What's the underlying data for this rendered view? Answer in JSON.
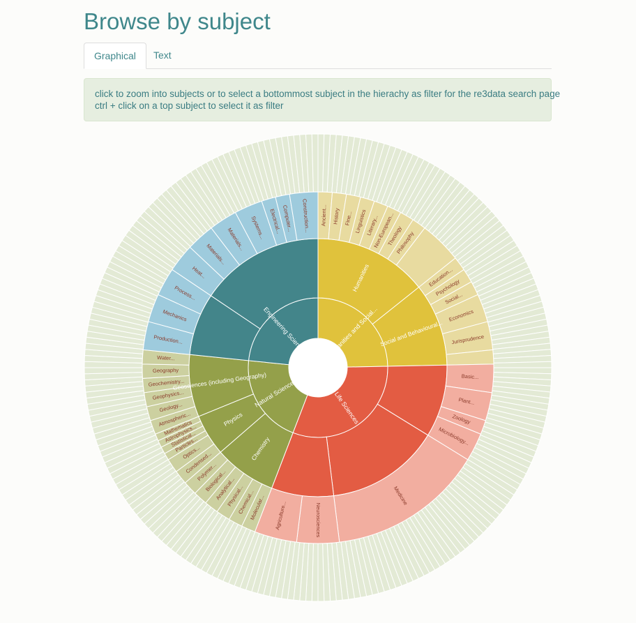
{
  "page": {
    "title": "Browse by subject",
    "tabs": [
      {
        "label": "Graphical",
        "active": true
      },
      {
        "label": "Text",
        "active": false
      }
    ],
    "info_lines": [
      "click to zoom into subjects or to select a bottommost subject in the hierachy as filter for the re3data search page",
      "ctrl + click on a top subject to select it as filter"
    ]
  },
  "colors": {
    "humanities": [
      "#e0c23c",
      "#e8dba0"
    ],
    "life": [
      "#e35c43",
      "#f2aea0"
    ],
    "natural": [
      "#94a04a",
      "#ccd0a0"
    ],
    "engineering": [
      "#43858a",
      "#9ecbdd"
    ],
    "outer": "#e3ead5"
  },
  "chart_data": {
    "type": "sunburst",
    "center_gap": true,
    "root_children": [
      {
        "name": "Humanities and Social...",
        "color_key": "humanities",
        "children": [
          {
            "name": "Humanities",
            "value": 11,
            "children": [
              {
                "name": "Ancient...",
                "value": 1
              },
              {
                "name": "History",
                "value": 1
              },
              {
                "name": "Fine...",
                "value": 1
              },
              {
                "name": "Linguistics",
                "value": 1
              },
              {
                "name": "Literary...",
                "value": 1
              },
              {
                "name": "Non-European...",
                "value": 1
              },
              {
                "name": "Theology",
                "value": 1
              },
              {
                "name": "Philosophy",
                "value": 1
              },
              {
                "name": "",
                "value": 3
              }
            ]
          },
          {
            "name": "Social and Behavioural...",
            "value": 8,
            "children": [
              {
                "name": "Education...",
                "value": 1
              },
              {
                "name": "Psychology",
                "value": 1
              },
              {
                "name": "Social...",
                "value": 1
              },
              {
                "name": "Economics",
                "value": 2
              },
              {
                "name": "Jurisprudence",
                "value": 2
              },
              {
                "name": "",
                "value": 1
              }
            ]
          }
        ]
      },
      {
        "name": "Life Sciences",
        "color_key": "life",
        "children": [
          {
            "name": "",
            "value": 7,
            "children": [
              {
                "name": "Basic...",
                "value": 2
              },
              {
                "name": "Plant...",
                "value": 2
              },
              {
                "name": "Zoology",
                "value": 1
              },
              {
                "name": "Microbiology...",
                "value": 2
              }
            ]
          },
          {
            "name": "",
            "value": 11,
            "children": [
              {
                "name": "Medicine",
                "value": 11
              }
            ]
          },
          {
            "name": "",
            "value": 6,
            "children": [
              {
                "name": "Neurosciences",
                "value": 3
              },
              {
                "name": "Agriculture...",
                "value": 3
              }
            ]
          }
        ]
      },
      {
        "name": "Natural Sciences",
        "color_key": "natural",
        "children": [
          {
            "name": "Chemistry",
            "value": 6,
            "children": [
              {
                "name": "Molecular...",
                "value": 1
              },
              {
                "name": "Chemical...",
                "value": 1
              },
              {
                "name": "Physical...",
                "value": 1
              },
              {
                "name": "Analytical...",
                "value": 1
              },
              {
                "name": "Biological...",
                "value": 1
              },
              {
                "name": "Polymer...",
                "value": 1
              }
            ]
          },
          {
            "name": "Physics",
            "value": 4,
            "children": [
              {
                "name": "Condensed...",
                "value": 1
              },
              {
                "name": "Optics...",
                "value": 1
              },
              {
                "name": "Particles...",
                "value": 0.5
              },
              {
                "name": "Statistical...",
                "value": 0.5
              },
              {
                "name": "Astrophysics...",
                "value": 0.5
              },
              {
                "name": "Mathematics",
                "value": 0.5
              }
            ]
          },
          {
            "name": "Geosciences (including Geography)",
            "value": 6,
            "children": [
              {
                "name": "Atmospheric...",
                "value": 1
              },
              {
                "name": "Geology...",
                "value": 1
              },
              {
                "name": "Geophysics...",
                "value": 1
              },
              {
                "name": "Geochemistry...",
                "value": 1
              },
              {
                "name": "Geography",
                "value": 1
              },
              {
                "name": "Water...",
                "value": 1
              }
            ]
          }
        ]
      },
      {
        "name": "Engineering Sciences",
        "color_key": "engineering",
        "children": [
          {
            "name": "",
            "value": 6,
            "children": [
              {
                "name": "Production...",
                "value": 2
              },
              {
                "name": "Mechanics",
                "value": 2
              },
              {
                "name": "Process...",
                "value": 2
              }
            ]
          },
          {
            "name": "",
            "value": 12,
            "children": [
              {
                "name": "Heat...",
                "value": 2
              },
              {
                "name": "Materials...",
                "value": 2
              },
              {
                "name": "Materials...",
                "value": 2
              },
              {
                "name": "Systems...",
                "value": 2
              },
              {
                "name": "Electrical...",
                "value": 1
              },
              {
                "name": "Computer...",
                "value": 1
              },
              {
                "name": "Construction...",
                "value": 2
              }
            ]
          }
        ]
      }
    ]
  }
}
